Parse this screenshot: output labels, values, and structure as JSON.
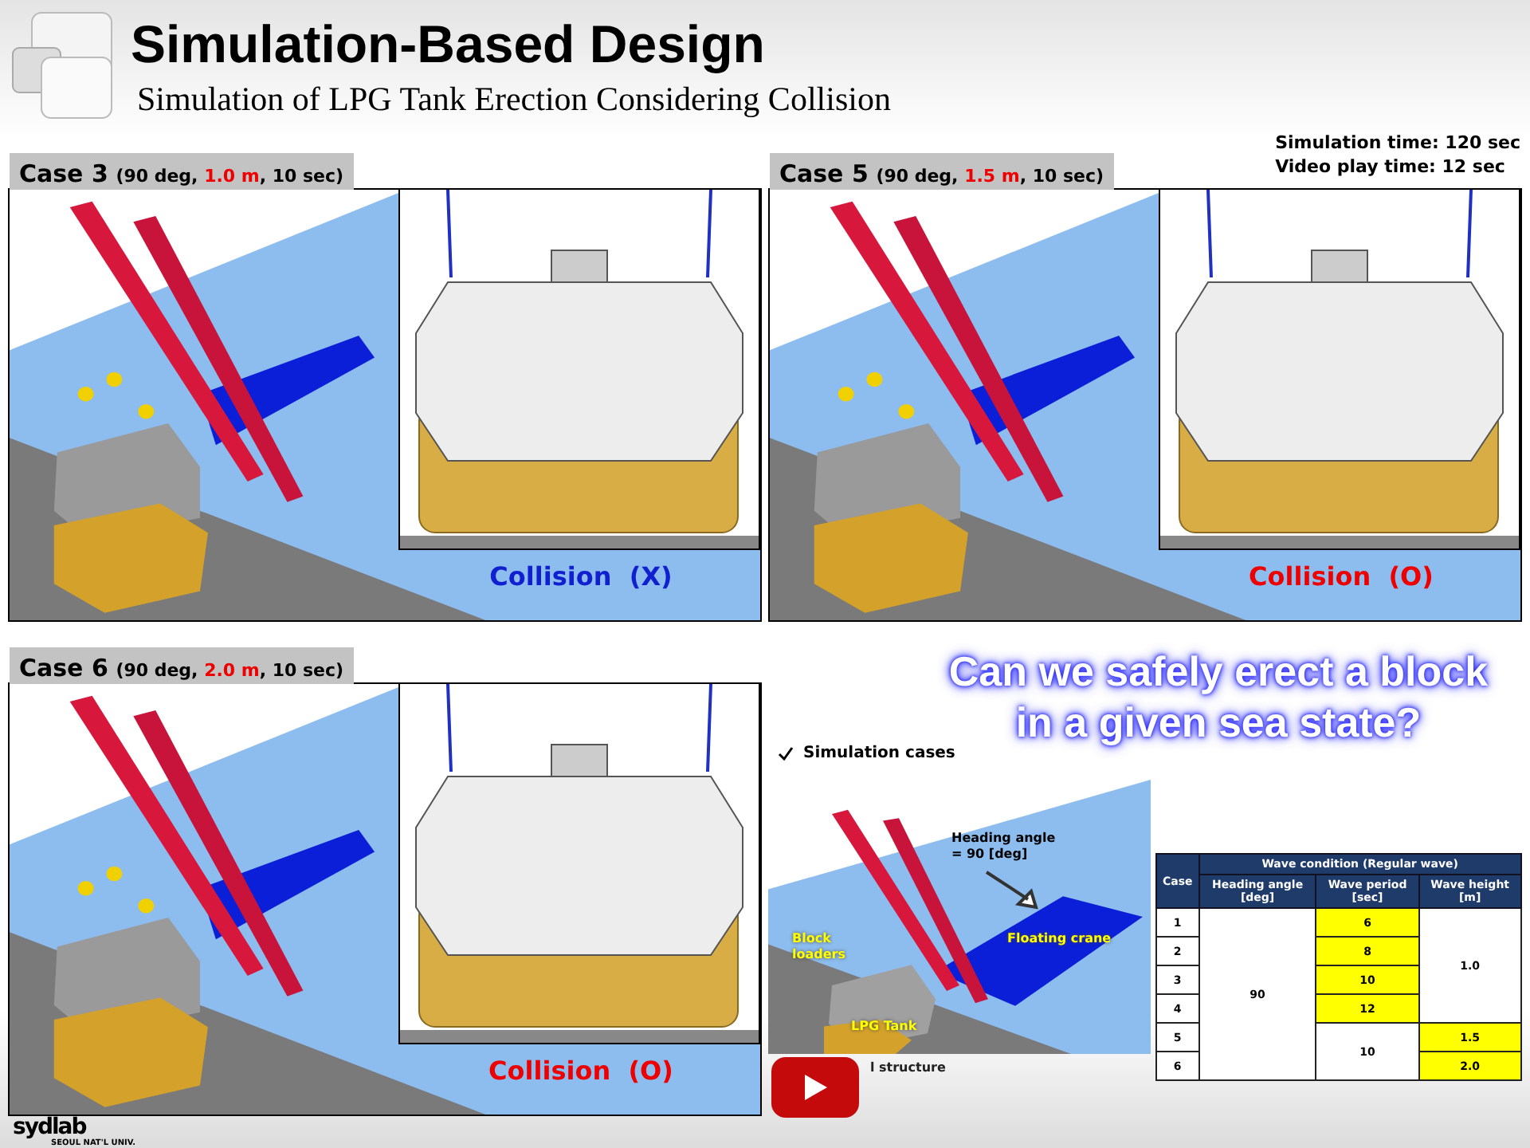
{
  "header": {
    "title": "Simulation-Based Design",
    "subtitle": "Simulation of LPG Tank Erection Considering Collision"
  },
  "sim_info": [
    "Simulation time: 120 sec",
    "Video play time: 12 sec"
  ],
  "cases": [
    {
      "label": "Case 3",
      "params_start": "(90 deg, ",
      "wave_height": "1.0 m",
      "params_end": ", 10 sec)",
      "result": "Collision  (X)",
      "collision": false
    },
    {
      "label": "Case 5",
      "params_start": "(90 deg, ",
      "wave_height": "1.5 m",
      "params_end": ", 10 sec)",
      "result": "Collision  (O)",
      "collision": true
    },
    {
      "label": "Case 6",
      "params_start": "(90 deg, ",
      "wave_height": "2.0 m",
      "params_end": ", 10 sec)",
      "result": "Collision  (O)",
      "collision": true
    }
  ],
  "question": "Can we safely erect a block in a given sea state?",
  "cases_section": {
    "heading": "Simulation cases",
    "heading_angle": [
      "Heading angle",
      "= 90 [deg]"
    ],
    "floating_crane": "Floating crane",
    "block_loaders": [
      "Block",
      "loaders"
    ],
    "lpg_tank": "LPG Tank",
    "structure": "l structure"
  },
  "table": {
    "case_header": "Case",
    "group_header": "Wave condition (Regular wave)",
    "columns": [
      [
        "Heading angle",
        "[deg]"
      ],
      [
        "Wave period",
        "[sec]"
      ],
      [
        "Wave height",
        "[m]"
      ]
    ],
    "rows": [
      {
        "case": "1",
        "heading": {
          "text": "90",
          "highlighted": false
        },
        "period": {
          "text": "6",
          "highlighted": true
        },
        "height": {
          "text": "1.0",
          "highlighted": false
        }
      },
      {
        "case": "2",
        "period": {
          "text": "8",
          "highlighted": true
        }
      },
      {
        "case": "3",
        "period": {
          "text": "10",
          "highlighted": true
        }
      },
      {
        "case": "4",
        "period": {
          "text": "12",
          "highlighted": true
        }
      },
      {
        "case": "5",
        "period": {
          "text": "10",
          "highlighted": false
        },
        "height": {
          "text": "1.5",
          "highlighted": true
        }
      },
      {
        "case": "6",
        "height": {
          "text": "2.0",
          "highlighted": true
        }
      }
    ]
  },
  "logo": {
    "name": "sydlab",
    "tagline": "SEOUL NAT'L UNIV."
  }
}
